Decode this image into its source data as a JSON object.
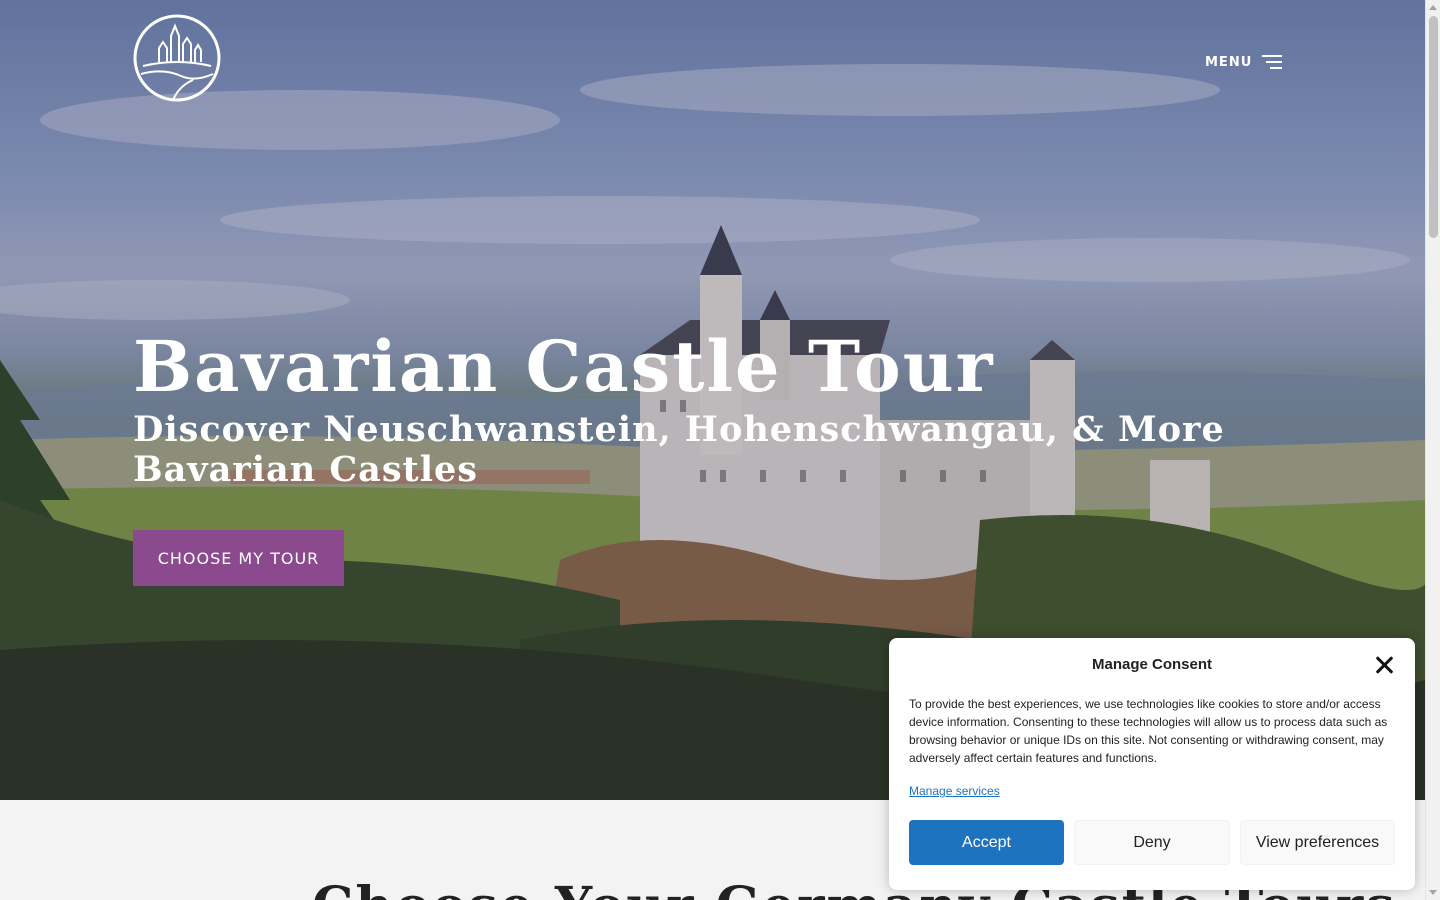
{
  "header": {
    "menu_label": "MENU"
  },
  "hero": {
    "title": "Bavarian Castle Tour",
    "subtitle": "Discover Neuschwanstein, Hohenschwangau, & More Bavarian Castles",
    "cta_label": "CHOOSE MY TOUR"
  },
  "section": {
    "title": "Choose Your Germany Castle Tours"
  },
  "consent": {
    "title": "Manage Consent",
    "text": "To provide the best experiences, we use technologies like cookies to store and/or access device information. Consenting to these technologies will allow us to process data such as browsing behavior or unique IDs on this site. Not consenting or withdrawing consent, may adversely affect certain features and functions.",
    "manage_services_label": "Manage services",
    "accept_label": "Accept",
    "deny_label": "Deny",
    "preferences_label": "View preferences"
  },
  "colors": {
    "cta": "#8a4a8d",
    "accept": "#1e73be",
    "link": "#1e73be"
  },
  "icons": {
    "logo": "castle-logo-icon",
    "menu": "hamburger-icon",
    "close": "close-icon"
  }
}
